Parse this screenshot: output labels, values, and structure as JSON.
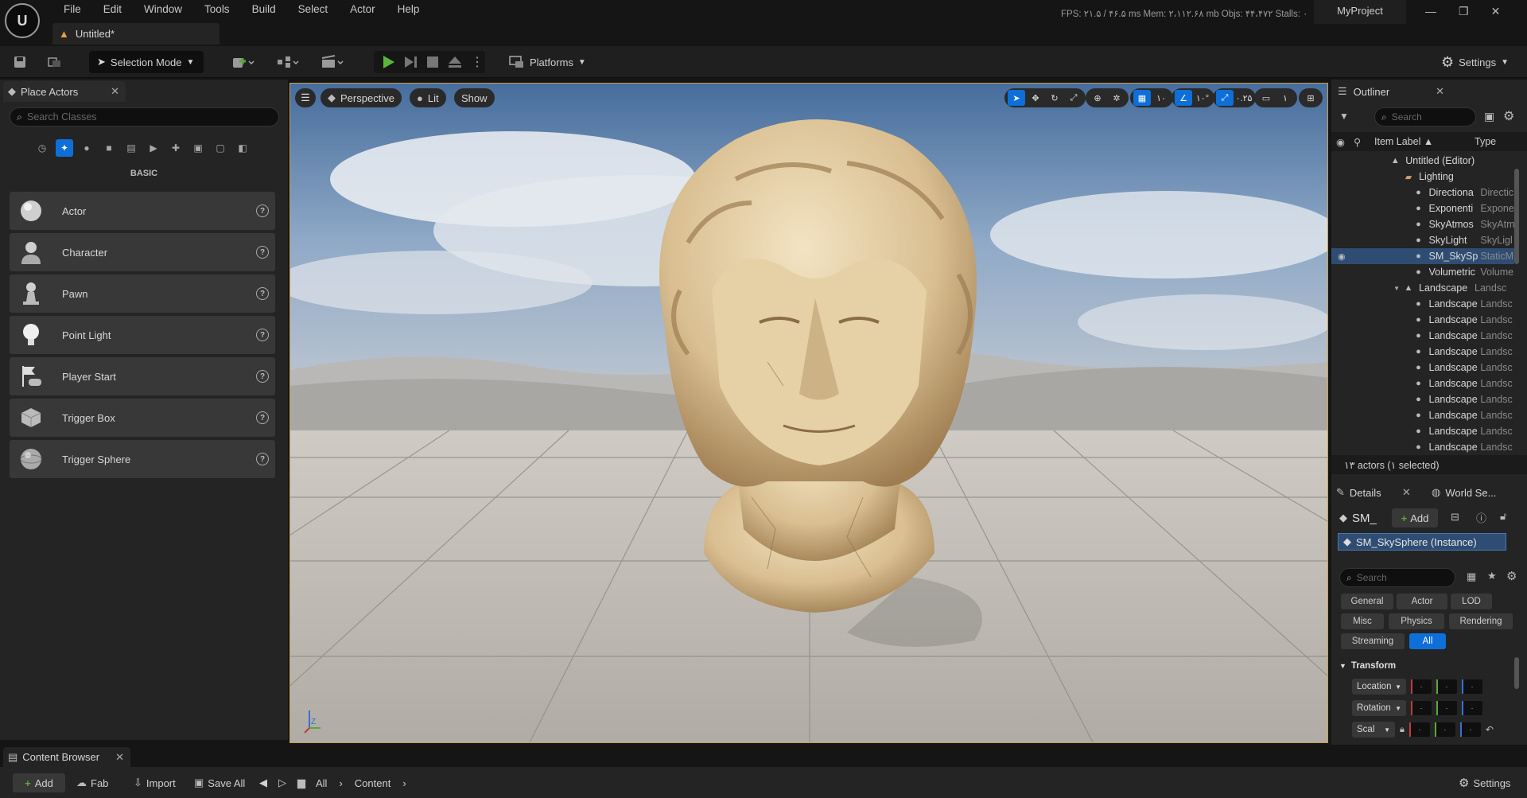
{
  "menubar": {
    "logo": "U",
    "items": [
      "File",
      "Edit",
      "Window",
      "Tools",
      "Build",
      "Select",
      "Actor",
      "Help"
    ],
    "document_tab": "Untitled*",
    "stats": "FPS: ۲۱.۵  /  ۴۶.۵ ms   Mem: ۲،۱۱۲.۶۸ mb   Objs: ۴۴،۴۷۲   Stalls: ۰",
    "project": "MyProject"
  },
  "toolbar": {
    "selection_mode": "Selection Mode",
    "platforms": "Platforms",
    "settings": "Settings"
  },
  "place_actors": {
    "tab_label": "Place Actors",
    "search_placeholder": "Search Classes",
    "section": "BASIC",
    "items": [
      {
        "label": "Actor",
        "icon": "sphere-icon"
      },
      {
        "label": "Character",
        "icon": "character-icon"
      },
      {
        "label": "Pawn",
        "icon": "pawn-icon"
      },
      {
        "label": "Point Light",
        "icon": "light-bulb-icon"
      },
      {
        "label": "Player Start",
        "icon": "player-start-icon"
      },
      {
        "label": "Trigger Box",
        "icon": "cube-icon"
      },
      {
        "label": "Trigger Sphere",
        "icon": "sphere-icon"
      }
    ]
  },
  "viewport": {
    "perspective": "Perspective",
    "lit": "Lit",
    "show": "Show",
    "grid_value": "۱۰",
    "angle_value": "۱۰°",
    "scale_value": "۰.۲۵",
    "camera_value": "۱",
    "axis_z": "Z"
  },
  "outliner": {
    "tab_label": "Outliner",
    "search_placeholder": "Search",
    "col_label": "Item Label ▲",
    "col_type": "Type",
    "rows": [
      {
        "name": "Untitled (Editor)",
        "type": "",
        "indent": 0
      },
      {
        "name": "Lighting",
        "type": "",
        "indent": 1
      },
      {
        "name": "Directiona",
        "type": "Directic",
        "indent": 2
      },
      {
        "name": "Exponenti",
        "type": "Expone",
        "indent": 2
      },
      {
        "name": "SkyAtmos",
        "type": "SkyAtm",
        "indent": 2
      },
      {
        "name": "SkyLight",
        "type": "SkyLigl",
        "indent": 2
      },
      {
        "name": "SM_SkySp",
        "type": "StaticM",
        "indent": 2,
        "selected": true
      },
      {
        "name": "Volumetric",
        "type": "Volume",
        "indent": 2
      },
      {
        "name": "Landscape",
        "type": "Landsc",
        "indent": 1
      },
      {
        "name": "Landscape",
        "type": "Landsc",
        "indent": 2
      },
      {
        "name": "Landscape",
        "type": "Landsc",
        "indent": 2
      },
      {
        "name": "Landscape",
        "type": "Landsc",
        "indent": 2
      },
      {
        "name": "Landscape",
        "type": "Landsc",
        "indent": 2
      },
      {
        "name": "Landscape",
        "type": "Landsc",
        "indent": 2
      },
      {
        "name": "Landscape",
        "type": "Landsc",
        "indent": 2
      },
      {
        "name": "Landscape",
        "type": "Landsc",
        "indent": 2
      },
      {
        "name": "Landscape",
        "type": "Landsc",
        "indent": 2
      },
      {
        "name": "Landscape",
        "type": "Landsc",
        "indent": 2
      },
      {
        "name": "Landscape",
        "type": "Landsc",
        "indent": 2
      }
    ],
    "footer": "۱۳ actors (۱ selected)"
  },
  "details": {
    "tab_label": "Details",
    "world_tab_label": "World Se...",
    "actor_name": "SM_",
    "add_label": "Add",
    "component": "SM_SkySphere (Instance)",
    "search_placeholder": "Search",
    "filters": [
      "General",
      "Actor",
      "LOD",
      "Misc",
      "Physics",
      "Rendering",
      "Streaming",
      "All"
    ],
    "active_filter": "All",
    "section": "Transform",
    "rows": [
      "Location",
      "Rotation",
      "Scal"
    ],
    "field_value": "۰"
  },
  "content_browser": {
    "tab_label": "Content Browser",
    "add": "Add",
    "fab": "Fab",
    "import": "Import",
    "save_all": "Save All",
    "path": [
      "All",
      "Content"
    ],
    "settings": "Settings"
  }
}
